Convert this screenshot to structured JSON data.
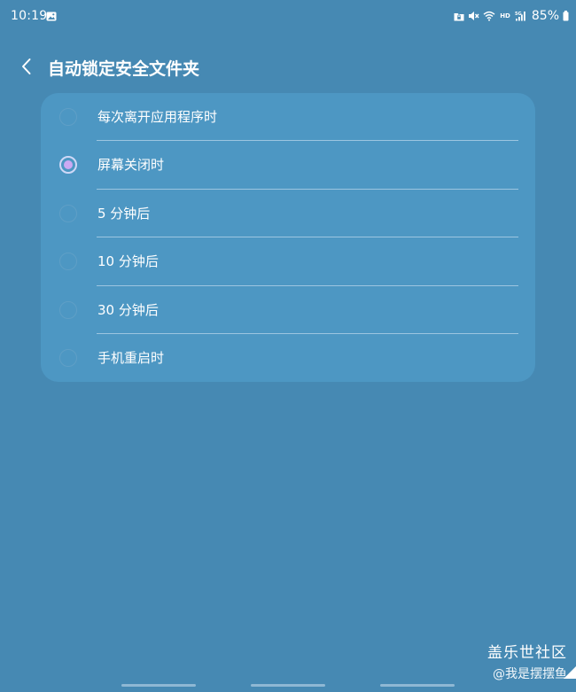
{
  "status_bar": {
    "time": "10:19",
    "battery_percent": "85%",
    "network": "HD",
    "icons": [
      "gallery-icon",
      "folder-lock-icon",
      "mute-icon",
      "wifi-icon",
      "signal-5g-icon",
      "battery-icon"
    ]
  },
  "header": {
    "back_icon": "chevron-left-icon",
    "title": "自动锁定安全文件夹"
  },
  "options": [
    {
      "label": "每次离开应用程序时",
      "selected": false
    },
    {
      "label": "屏幕关闭时",
      "selected": true
    },
    {
      "label": "5 分钟后",
      "selected": false
    },
    {
      "label": "10 分钟后",
      "selected": false
    },
    {
      "label": "30 分钟后",
      "selected": false
    },
    {
      "label": "手机重启时",
      "selected": false
    }
  ],
  "watermark": {
    "site": "盖乐世社区",
    "user": "@我是摆摆鱼"
  },
  "colors": {
    "background": "#4689b3",
    "card": "#4d97c3",
    "radio_selected": "#cba9f3"
  }
}
